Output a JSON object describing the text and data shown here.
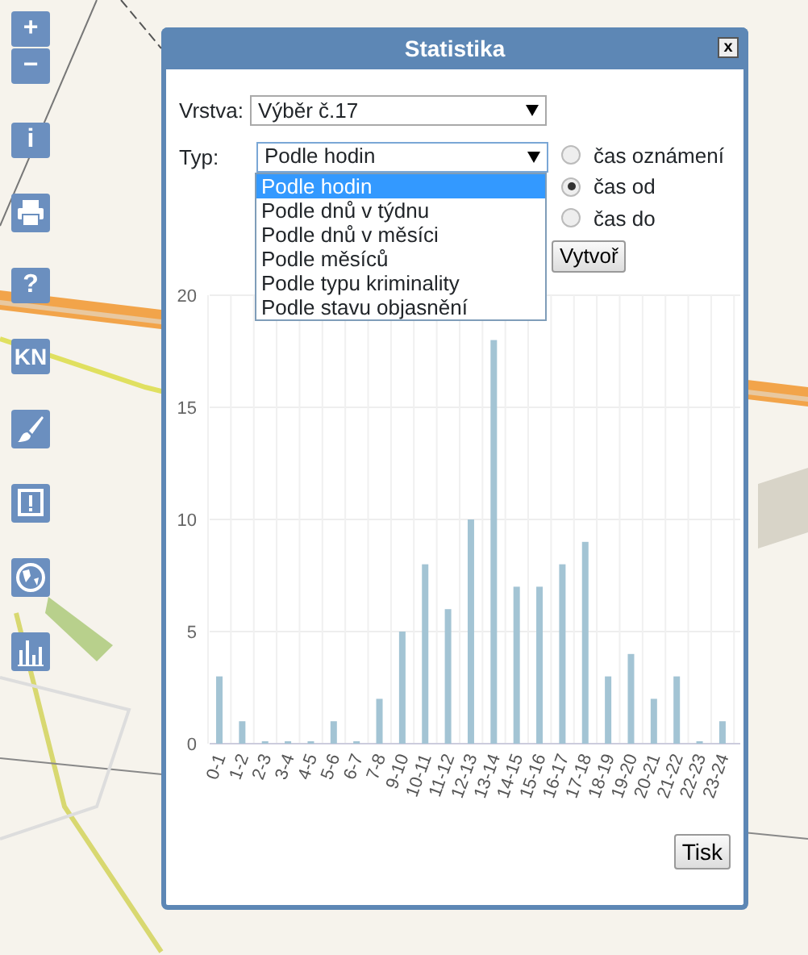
{
  "toolbar": [
    {
      "kind": "text",
      "label": "+"
    },
    {
      "kind": "text",
      "label": "−"
    },
    {
      "kind": "text",
      "label": "i"
    },
    {
      "kind": "printer"
    },
    {
      "kind": "text",
      "label": "?"
    },
    {
      "kind": "text",
      "label": "KN"
    },
    {
      "kind": "brush"
    },
    {
      "kind": "alert"
    },
    {
      "kind": "globe"
    },
    {
      "kind": "chart"
    }
  ],
  "dialog": {
    "title": "Statistika",
    "close": "x",
    "layer": {
      "label": "Vrstva:",
      "value": "Výběr č.17"
    },
    "type": {
      "label": "Typ:",
      "value": "Podle hodin",
      "expanded": true,
      "options": [
        {
          "label": "Podle hodin",
          "selected": true
        },
        {
          "label": "Podle dnů v týdnu",
          "selected": false
        },
        {
          "label": "Podle dnů v měsíci",
          "selected": false
        },
        {
          "label": "Podle měsíců",
          "selected": false
        },
        {
          "label": "Podle typu kriminality",
          "selected": false
        },
        {
          "label": "Podle stavu objasnění",
          "selected": false
        }
      ]
    },
    "time_options": [
      {
        "label": "čas oznámení",
        "selected": false
      },
      {
        "label": "čas od",
        "selected": true
      },
      {
        "label": "čas do",
        "selected": false
      }
    ],
    "create_button": "Vytvoř",
    "chart_data": {
      "type": "bar",
      "categories": [
        "0-1",
        "1-2",
        "2-3",
        "3-4",
        "4-5",
        "5-6",
        "6-7",
        "7-8",
        "9-10",
        "10-11",
        "11-12",
        "12-13",
        "13-14",
        "14-15",
        "15-16",
        "16-17",
        "17-18",
        "18-19",
        "19-20",
        "20-21",
        "21-22",
        "22-23",
        "23-24"
      ],
      "series": [
        {
          "color": "#a3c4d4",
          "values": [
            3,
            1,
            0,
            0,
            0,
            1,
            0,
            2,
            5,
            8,
            6,
            10,
            18,
            7,
            7,
            8,
            9,
            3,
            4,
            2,
            3,
            0,
            1
          ]
        }
      ],
      "ylim": [
        0,
        20
      ],
      "grid": true,
      "yticks": [
        0,
        5,
        10,
        15,
        20
      ]
    },
    "print_button": "Tisk"
  }
}
